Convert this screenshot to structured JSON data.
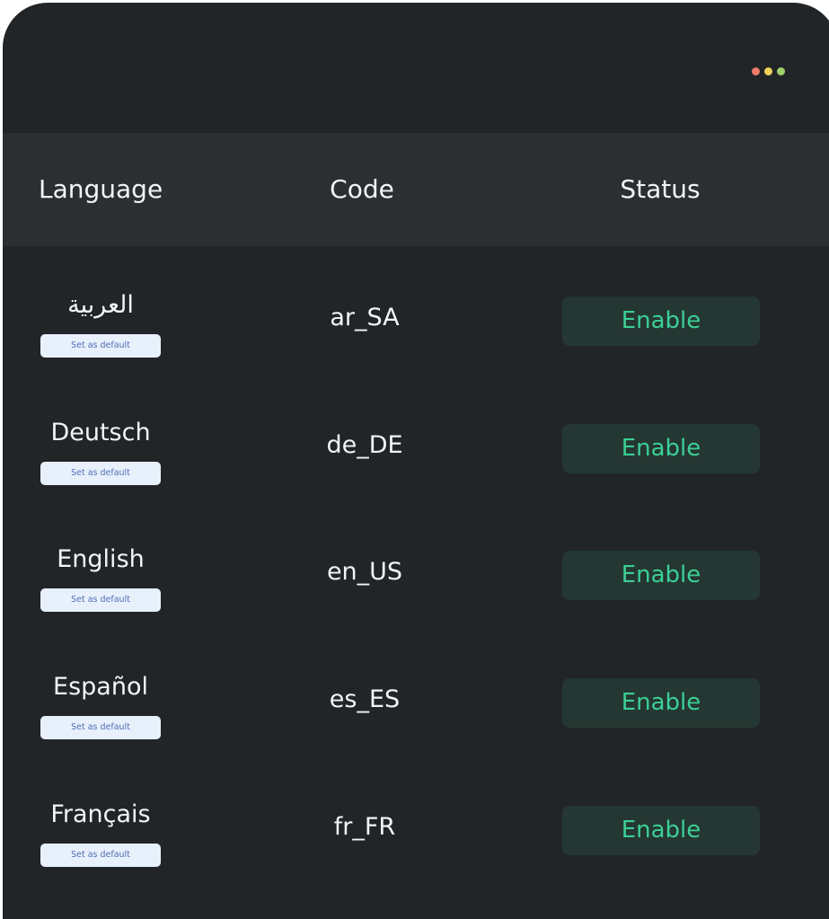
{
  "table": {
    "headers": {
      "language": "Language",
      "code": "Code",
      "status": "Status"
    },
    "rows": [
      {
        "language": "العربية",
        "code": "ar_SA",
        "status": "Enable",
        "default_label": "Set as default"
      },
      {
        "language": "Deutsch",
        "code": "de_DE",
        "status": "Enable",
        "default_label": "Set as default"
      },
      {
        "language": "English",
        "code": "en_US",
        "status": "Enable",
        "default_label": "Set as default"
      },
      {
        "language": "Español",
        "code": "es_ES",
        "status": "Enable",
        "default_label": "Set as default"
      },
      {
        "language": "Français",
        "code": "fr_FR",
        "status": "Enable",
        "default_label": "Set as default"
      }
    ]
  },
  "window": {
    "controls": [
      "red-dot",
      "yellow-dot",
      "green-dot"
    ]
  },
  "colors": {
    "background": "#222528",
    "header": "#2c2f32",
    "status_text": "#3ccf95",
    "status_bg": "#243732",
    "default_btn_bg": "#e8f0fc",
    "default_btn_text": "#4f6fb5"
  }
}
